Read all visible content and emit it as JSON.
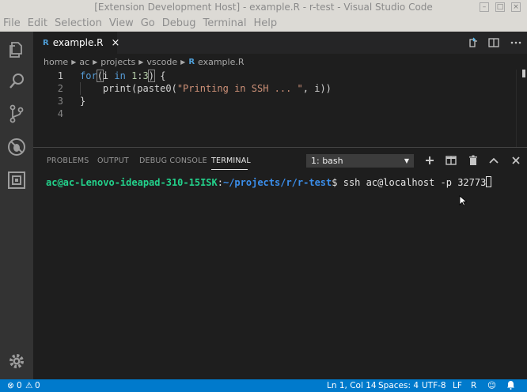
{
  "window": {
    "title": "[Extension Development Host] - example.R - r-test - Visual Studio Code"
  },
  "menu": [
    "File",
    "Edit",
    "Selection",
    "View",
    "Go",
    "Debug",
    "Terminal",
    "Help"
  ],
  "activity_bar": {
    "icons": [
      "files-icon",
      "search-icon",
      "source-control-icon",
      "extensions-icon",
      "remote-explorer-icon"
    ],
    "bottom_icon": "gear-icon"
  },
  "editor_tab": {
    "file_icon": "R",
    "label": "example.R",
    "close": "×"
  },
  "breadcrumb": {
    "items": [
      "home",
      "ac",
      "projects",
      "vscode"
    ],
    "file_icon": "R",
    "file": "example.R"
  },
  "editor": {
    "lines": [
      {
        "number": "1",
        "active": true
      },
      {
        "number": "2"
      },
      {
        "number": "3"
      },
      {
        "number": "4"
      }
    ]
  },
  "panel": {
    "tabs": [
      "PROBLEMS",
      "OUTPUT",
      "DEBUG CONSOLE",
      "TERMINAL"
    ],
    "active_tab": "TERMINAL",
    "terminal_select": "1: bash",
    "terminal": {
      "user_host": "ac@ac-Lenovo-ideapad-310-15ISK",
      "separator": ":",
      "path": "~/projects/r/r-test",
      "prompt": "$ ",
      "command": "ssh ac@localhost -p 32773"
    }
  },
  "status_bar": {
    "errors": "0",
    "warnings": "0",
    "position": "Ln 1, Col 14",
    "spaces": "Spaces: 4",
    "encoding": "UTF-8",
    "eol": "LF",
    "language": "R"
  },
  "colors": {
    "accent": "#007acc",
    "terminal_user": "#23d18b",
    "terminal_path": "#3b8eea"
  }
}
